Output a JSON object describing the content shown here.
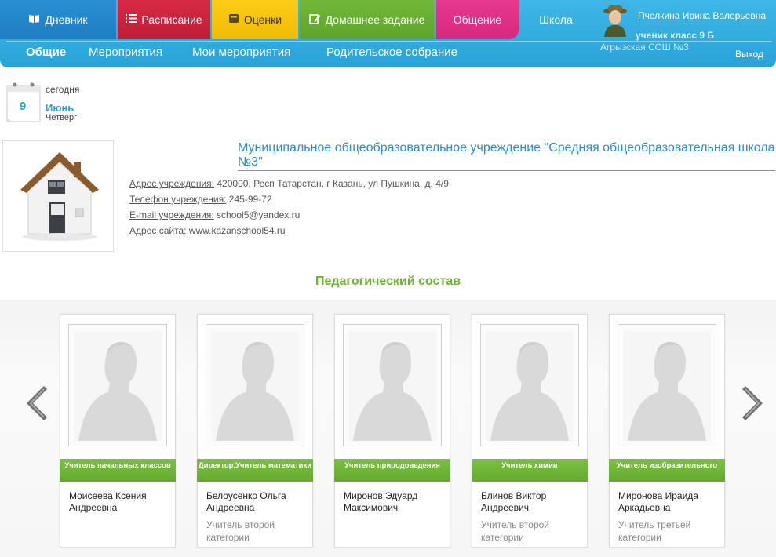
{
  "nav": {
    "tabs": [
      {
        "label": "Дневник",
        "icon": "book-icon"
      },
      {
        "label": "Расписание",
        "icon": "list-icon"
      },
      {
        "label": "Оценки",
        "icon": "grades-icon"
      },
      {
        "label": "Домашнее задание",
        "icon": "edit-icon"
      },
      {
        "label": "Общение",
        "icon": ""
      },
      {
        "label": "Школа",
        "icon": ""
      }
    ],
    "subnav": [
      "Общие",
      "Мероприятия",
      "Мои мероприятия",
      "Родительское собрание"
    ],
    "colors": {
      "diary": "#1f7cc2",
      "schedule": "#c11d37",
      "grades": "#f0bb04",
      "homework": "#5ea42a",
      "communication": "#d82a7c",
      "bar": "#29a3d8"
    }
  },
  "user": {
    "name": "Пчелкина Ирина Валерьевна",
    "role": "ученик класс 9 Б",
    "school": "Агрызская СОШ №3",
    "logout": "Выход"
  },
  "date": {
    "today": "сегодня",
    "day": "9",
    "month": "Июнь",
    "weekday": "Четверг"
  },
  "school": {
    "title": "Муниципальное общеобразовательное учреждение \"Средняя общеобразовательная школа №3\"",
    "address_label": "Адрес учреждения:",
    "address": "420000, Респ Татарстан, г Казань, ул Пушкина, д. 4/9",
    "phone_label": "Телефон учреждения:",
    "phone": "245-99-72",
    "email_label": "E-mail учреждения:",
    "email": "school5@yandex.ru",
    "site_label": "Адрес сайта:",
    "site": "www.kazanschool54.ru"
  },
  "staff": {
    "heading": "Педагогический состав",
    "teachers": [
      {
        "role": "Учитель начальных классов",
        "name": "Моисеева Ксения Андреевна",
        "category": ""
      },
      {
        "role": "Директор,Учитель математики",
        "name": "Белоусенко Ольга Андреевна",
        "category": "Учитель второй категории"
      },
      {
        "role": "Учитель природоведения",
        "name": "Миронов Эдуард Максимович",
        "category": ""
      },
      {
        "role": "Учитель химии",
        "name": "Блинов Виктор Андреевич",
        "category": "Учитель второй категории"
      },
      {
        "role": "Учитель изобразительного",
        "name": "Миронова Ираида Аркадьевна",
        "category": "Учитель третьей категории"
      }
    ]
  }
}
